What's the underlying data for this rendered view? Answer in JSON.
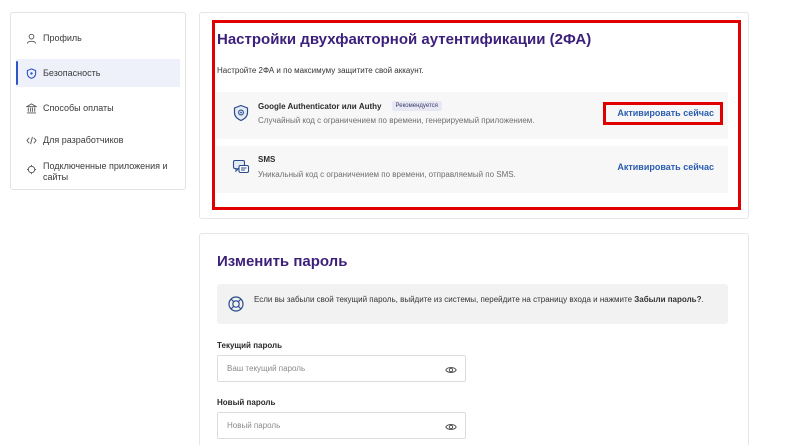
{
  "sidebar": {
    "items": [
      {
        "label": "Профиль",
        "icon": "user-icon"
      },
      {
        "label": "Безопасность",
        "icon": "shield-icon",
        "active": true
      },
      {
        "label": "Способы оплаты",
        "icon": "bank-icon"
      },
      {
        "label": "Для разработчиков",
        "icon": "code-icon"
      },
      {
        "label": "Подключенные приложения и сайты",
        "icon": "plug-icon"
      }
    ]
  },
  "twofa": {
    "title": "Настройки двухфакторной аутентификации (2ФА)",
    "subtitle": "Настройте 2ФА и по максимуму защитите свой аккаунт.",
    "options": [
      {
        "title": "Google Authenticator или Authy",
        "badge": "Рекомендуется",
        "description": "Случайный код с ограничением по времени, генерируемый приложением.",
        "action": "Активировать сейчас",
        "icon": "authenticator-shield-icon"
      },
      {
        "title": "SMS",
        "badge": "",
        "description": "Уникальный код с ограничением по времени, отправляемый по SMS.",
        "action": "Активировать сейчас",
        "icon": "sms-chat-icon"
      }
    ]
  },
  "password": {
    "title": "Изменить пароль",
    "info_text": "Если вы забыли свой текущий пароль, выйдите из системы, перейдите на страницу входа и нажмите ",
    "info_bold": "Забыли пароль?",
    "info_end": ".",
    "current_label": "Текущий пароль",
    "current_placeholder": "Ваш текущий пароль",
    "new_label": "Новый пароль",
    "new_placeholder": "Новый пароль"
  },
  "colors": {
    "heading": "#3b1f7a",
    "link": "#2a5db0",
    "highlight": "#e00000",
    "active_accent": "#2f54c8"
  }
}
